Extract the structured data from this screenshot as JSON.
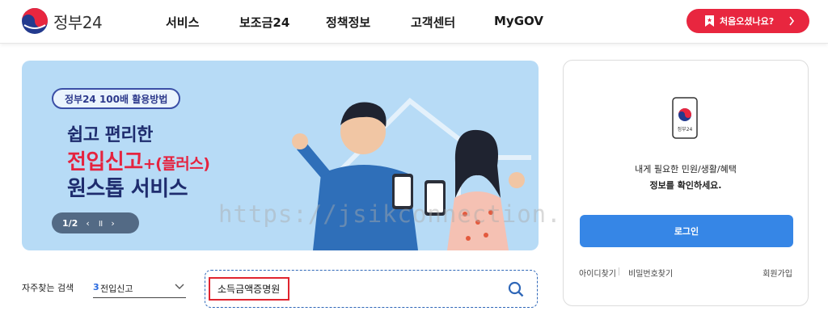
{
  "header": {
    "logo_text": "정부24",
    "nav": [
      "서비스",
      "보조금24",
      "정책정보",
      "고객센터",
      "MyGOV"
    ],
    "first_visit_label": "처음오셨나요?",
    "first_visit_icon": "bookmark-icon"
  },
  "banner": {
    "pill": "정부24 100배 활용방법",
    "line1": "쉽고 편리한",
    "line2_main": "전입신고",
    "line2_plus": "+(플러스)",
    "line3": "원스톱 서비스",
    "page": "1/2",
    "prev": "‹",
    "pause": "॥",
    "next": "›"
  },
  "search": {
    "label": "자주찾는 검색",
    "keyword_num": "3",
    "keyword_text": "전입신고",
    "input_value": "소득금액증명원"
  },
  "login": {
    "phone_caption": "정부24",
    "msg1": "내게 필요한 민원/생활/혜택",
    "msg2": "정보를 확인하세요.",
    "button": "로그인",
    "find_id": "아이디찾기",
    "find_pw": "비밀번호찾기",
    "signup": "회원가입"
  },
  "watermark": "https://jsikconnection.com/",
  "colors": {
    "accent_red": "#e8263f",
    "login_blue": "#3686e6",
    "banner_bg": "#b7dbf6"
  }
}
